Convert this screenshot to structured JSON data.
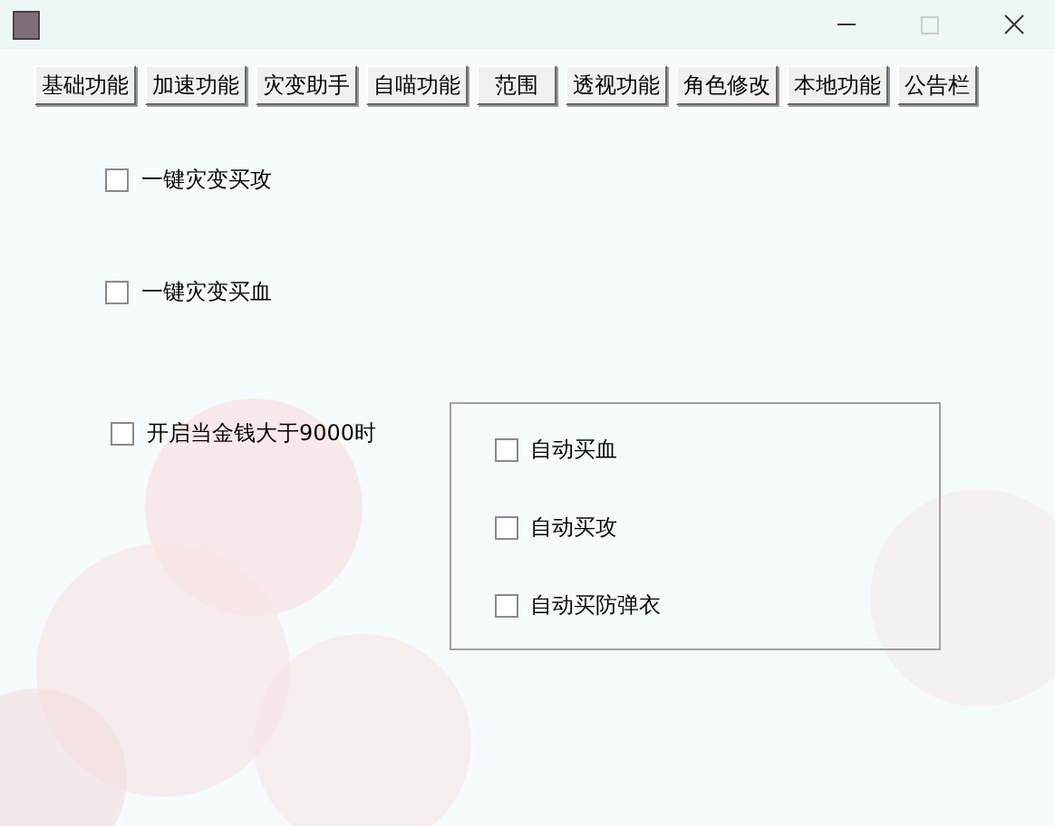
{
  "tabs": [
    {
      "label": "基础功能",
      "selected": false
    },
    {
      "label": "加速功能",
      "selected": false
    },
    {
      "label": "灾变助手",
      "selected": false
    },
    {
      "label": "自喵功能",
      "selected": false
    },
    {
      "label": "范围",
      "selected": false
    },
    {
      "label": "透视功能",
      "selected": false
    },
    {
      "label": "角色修改",
      "selected": false
    },
    {
      "label": "本地功能",
      "selected": false
    },
    {
      "label": "公告栏",
      "selected": false
    }
  ],
  "options": [
    {
      "label": "一键灾变买攻",
      "checked": false
    },
    {
      "label": "一键灾变买血",
      "checked": false
    },
    {
      "label": "开启当金钱大于9000时",
      "checked": false
    }
  ],
  "group_options": [
    {
      "label": "自动买血",
      "checked": false
    },
    {
      "label": "自动买攻",
      "checked": false
    },
    {
      "label": "自动买防弹衣",
      "checked": false
    }
  ]
}
